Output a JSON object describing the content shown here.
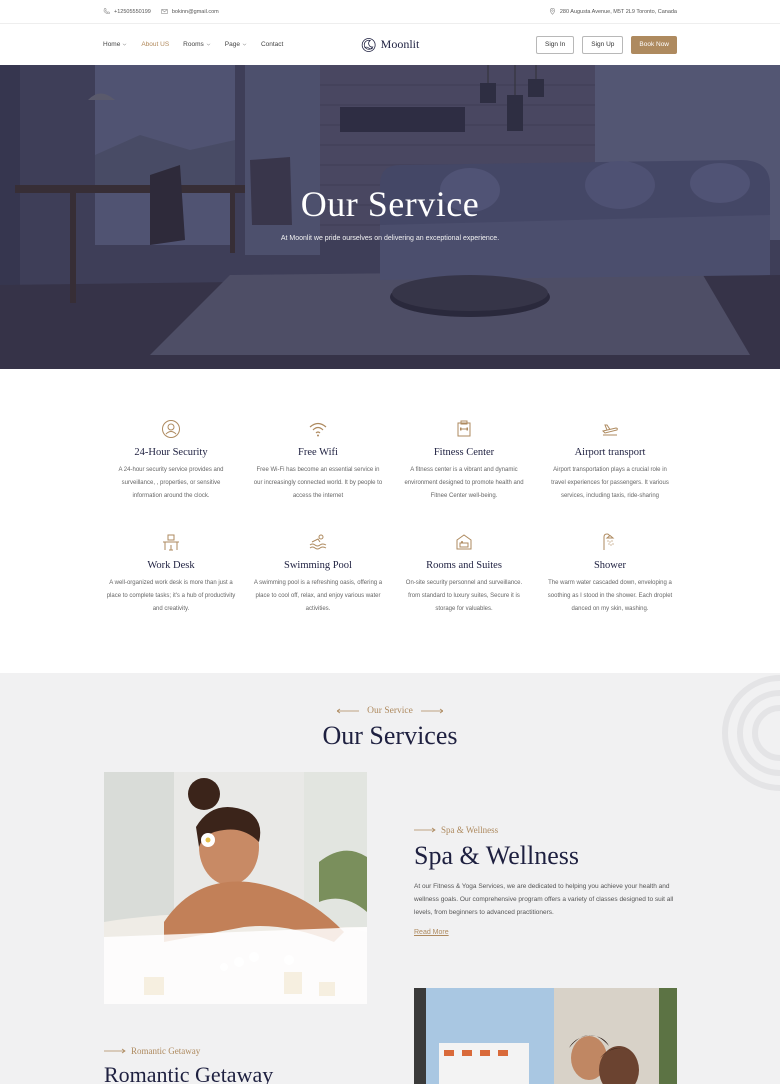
{
  "topbar": {
    "phone": "+12505550199",
    "email": "bokinn@gmail.com",
    "address": "280 Augusta Avenue, M5T 2L9 Toronto, Canada"
  },
  "nav": {
    "menu": [
      {
        "label": "Home",
        "has_dropdown": true,
        "active": false
      },
      {
        "label": "About US",
        "has_dropdown": false,
        "active": true
      },
      {
        "label": "Rooms",
        "has_dropdown": true,
        "active": false
      },
      {
        "label": "Page",
        "has_dropdown": true,
        "active": false
      },
      {
        "label": "Contact",
        "has_dropdown": false,
        "active": false
      }
    ],
    "logo_text": "Moonlit",
    "sign_in": "Sign In",
    "sign_up": "Sign Up",
    "book_now": "Book Now"
  },
  "hero": {
    "title": "Our Service",
    "subtitle": "At Moonlit we pride ourselves on delivering an exceptional experience."
  },
  "features": [
    {
      "icon": "security-icon",
      "title": "24-Hour Security",
      "desc": "A 24-hour security service provides and surveillance,  , properties, or sensitive information around the clock."
    },
    {
      "icon": "wifi-icon",
      "title": "Free Wifi",
      "desc": "Free Wi-Fi has become an essential service in our increasingly connected world. It by people to access the internet"
    },
    {
      "icon": "fitness-icon",
      "title": "Fitness Center",
      "desc": "A fitness center is a vibrant and dynamic environment designed to promote health and Fitnee Center well-being."
    },
    {
      "icon": "plane-icon",
      "title": "Airport transport",
      "desc": "Airport transportation plays a crucial role in travel experiences for passengers. It  various services, including taxis, ride-sharing"
    },
    {
      "icon": "desk-icon",
      "title": "Work Desk",
      "desc": "A well-organized work desk is more than just a place to complete tasks; it's a hub of productivity and creativity."
    },
    {
      "icon": "pool-icon",
      "title": "Swimming Pool",
      "desc": "A swimming pool is a refreshing oasis, offering a place to cool off, relax, and enjoy various water activities."
    },
    {
      "icon": "bed-icon",
      "title": "Rooms and Suites",
      "desc": "On-site security personnel and surveillance. from standard to luxury suites, Secure it is storage for valuables."
    },
    {
      "icon": "shower-icon",
      "title": "Shower",
      "desc": "The warm water cascaded down, enveloping a soothing as I stood in the shower. Each droplet danced on my skin, washing."
    }
  ],
  "services": {
    "eyebrow": "Our Service",
    "title": "Our Services",
    "spa": {
      "eyebrow": "Spa & Wellness",
      "title": "Spa & Wellness",
      "desc": "At our Fitness & Yoga Services, we are dedicated to helping you achieve your health and wellness goals. Our comprehensive program offers a variety of classes designed to suit all levels, from beginners to advanced practitioners.",
      "link": "Read More"
    },
    "romantic": {
      "eyebrow": "Romantic Getaway",
      "title": "Romantic Getaway"
    }
  },
  "colors": {
    "accent": "#ae8a5f",
    "heading": "#1e2040",
    "section_bg": "#f1f1f2"
  }
}
